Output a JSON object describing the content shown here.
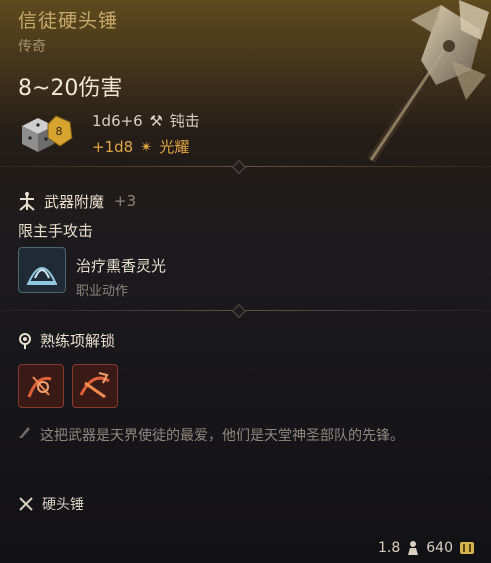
{
  "item": {
    "name": "信徒硬头锤",
    "rarity": "传奇",
    "damage_range": "8~20伤害",
    "damage_lines": [
      {
        "dice": "1d6+6",
        "type": "钝击",
        "color": "#d8cfc0"
      },
      {
        "dice": "+1d8",
        "type": "光耀",
        "color": "#e0a640"
      }
    ],
    "dice_badge": "8"
  },
  "enchant": {
    "label": "武器附魔",
    "bonus": "+3"
  },
  "main_hand": {
    "label": "限主手攻击",
    "action_name": "治疗熏香灵光",
    "action_type": "职业动作"
  },
  "proficiency": {
    "label": "熟练项解锁"
  },
  "flavor": "这把武器是天界使徒的最爱，他们是天堂神圣部队的先锋。",
  "weapon_type": "硬头锤",
  "footer": {
    "weight": "1.8",
    "value": "640"
  }
}
